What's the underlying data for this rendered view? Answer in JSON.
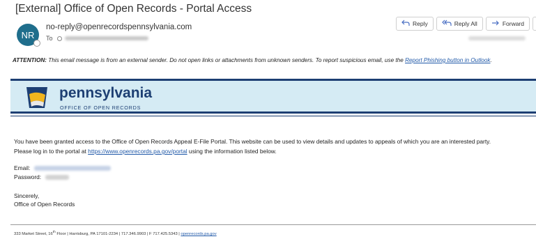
{
  "email": {
    "subject": "[External] Office of Open Records - Portal Access",
    "sender": {
      "initials": "NR",
      "address": "no-reply@openrecordspennsylvania.com",
      "to_label": "To"
    },
    "actions": {
      "reply": "Reply",
      "reply_all": "Reply All",
      "forward": "Forward",
      "more": "···"
    },
    "icons": {
      "reply": "reply-arrow-icon",
      "reply_all": "reply-all-arrow-icon",
      "forward": "forward-arrow-icon",
      "more": "more-dots-icon"
    },
    "attention": {
      "label": "ATTENTION:",
      "text": " This email message is from an external sender. Do not open links or attachments from unknown senders. To report suspicious email, use the ",
      "link": "Report Phishing button in Outlook",
      "end": "."
    }
  },
  "banner": {
    "name": "pennsylvania",
    "subtitle": "OFFICE OF OPEN RECORDS",
    "colors": {
      "navy": "#1d3f73",
      "gold": "#f2b51d",
      "light": "#d5ebf4"
    }
  },
  "message": {
    "line1": "You have been granted access to the Office of Open Records Appeal E-File Portal. This website can be used to view details and updates to appeals of which you are an interested party.",
    "line2_pre": "Please log in to the portal at ",
    "line2_link": "https://www.openrecords.pa.gov/portal",
    "line2_post": " using the information listed below.",
    "email_label": "Email:",
    "password_label": "Password:",
    "closing1": "Sincerely,",
    "closing2": "Office of Open Records"
  },
  "footer": {
    "address_pre": "333 Market Street, 16",
    "address_sup": "th",
    "address_post": " Floor | Harrisburg, PA 17101-2234 | 717.346.9903 | F 717.425.5343 | ",
    "link": "openrecords.pa.gov"
  }
}
